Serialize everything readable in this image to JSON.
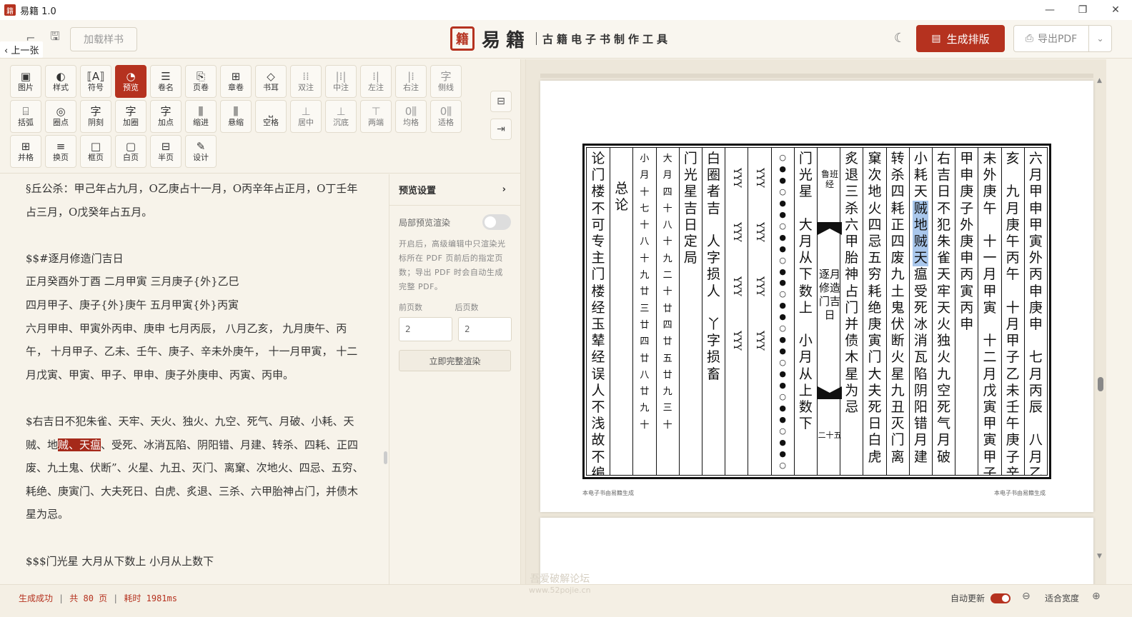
{
  "window": {
    "title": "易籍 1.0",
    "minimize": "—",
    "restore": "❐",
    "close": "✕"
  },
  "header": {
    "back_label": "上一张",
    "load_sample": "加载样书",
    "brand_seal": "籍",
    "brand_name": "易籍",
    "brand_subtitle": "古籍电子书制作工具",
    "generate_label": "生成排版",
    "export_label": "导出PDF",
    "theme_icon": "moon-icon"
  },
  "toolbar": {
    "row1": [
      {
        "icon": "▣",
        "label": "图片"
      },
      {
        "icon": "◐",
        "label": "样式"
      },
      {
        "icon": "⟦A⟧",
        "label": "符号"
      },
      {
        "icon": "◔",
        "label": "预览",
        "active": true
      },
      {
        "icon": "☰",
        "label": "卷名"
      },
      {
        "icon": "⎘",
        "label": "页卷"
      },
      {
        "icon": "⊞",
        "label": "章卷"
      },
      {
        "icon": "◇",
        "label": "书耳"
      },
      {
        "icon": "⁞⁞",
        "label": "双注",
        "dim": true
      },
      {
        "icon": "|⁞|",
        "label": "中注",
        "dim": true
      },
      {
        "icon": "⁞|",
        "label": "左注",
        "dim": true
      },
      {
        "icon": "|⁞",
        "label": "右注",
        "dim": true
      },
      {
        "icon": "字",
        "label": "侧线",
        "dim": true
      }
    ],
    "row2": [
      {
        "icon": "⌸",
        "label": "括弧"
      },
      {
        "icon": "◎",
        "label": "圈点"
      },
      {
        "icon": "字",
        "label": "阴刻"
      },
      {
        "icon": "字",
        "label": "加圈"
      },
      {
        "icon": "字",
        "label": "加点"
      },
      {
        "icon": "⫼",
        "label": "缩进"
      },
      {
        "icon": "⫼",
        "label": "悬缩"
      },
      {
        "icon": "⎵",
        "label": "空格"
      },
      {
        "icon": "⊥",
        "label": "居中",
        "dim": true
      },
      {
        "icon": "⊥",
        "label": "沉底",
        "dim": true
      },
      {
        "icon": "⊤",
        "label": "两端",
        "dim": true
      },
      {
        "icon": "0⫼",
        "label": "均格",
        "dim": true
      },
      {
        "icon": "0⫼",
        "label": "适格",
        "dim": true
      }
    ],
    "row3": [
      {
        "icon": "⊞",
        "label": "并格"
      },
      {
        "icon": "≡",
        "label": "换页"
      },
      {
        "icon": "□",
        "label": "框页"
      },
      {
        "icon": "▢",
        "label": "白页"
      },
      {
        "icon": "⊟",
        "label": "半页"
      },
      {
        "icon": "✎",
        "label": "设计"
      }
    ]
  },
  "editor": {
    "p1": "§丘公杀：甲己年占九月，O乙庚占十一月，O丙辛年占正月，O丁壬年占三月，O戊癸年占五月。",
    "p2": "$$#逐月修造门吉日",
    "p3a": "正月癸酉外丁酉 二月甲寅 三月庚子{外}乙巳",
    "p3b": "四月甲子、庚子{外}庚午 五月甲寅{外}丙寅",
    "p3c": "六月甲申、甲寅外丙申、庚申 七月丙辰， 八月乙亥， 九月庚午、丙午， 十月甲子、乙未、壬午、庚子、辛未外庚午， 十一月甲寅， 十二月戊寅、甲寅、甲子、甲申、庚子外庚申、丙寅、丙申。",
    "p4_pre": "$右吉日不犯朱雀、天牢、天火、独火、九空、死气、月破、小耗、天贼、地",
    "p4_hl": "贼、天瘟",
    "p4_post": "、受死、冰消瓦陷、阴阳错、月建、转杀、四耗、正四废、九土鬼、伏断”、火星、九丑、灭门、离窠、次地火、四忌、五穷、耗绝、庚寅门、大夫死日、白虎、炙退、三杀、六甲胎神占门，并债木星为忌。",
    "p5": "$$$门光星 大月从下数上 小月从上数下"
  },
  "settings": {
    "title": "预览设置",
    "partial_label": "局部预览渲染",
    "desc": "开启后，高级编辑中只渲染光标所在 PDF 页前后的指定页数；导出 PDF 时会自动生成完整 PDF。",
    "before_label": "前页数",
    "after_label": "后页数",
    "before_value": "2",
    "after_value": "2",
    "render_now": "立即完整渲染"
  },
  "preview": {
    "columns": [
      "六月甲申甲寅外丙申庚申 七月丙辰 八月乙",
      "亥 九月庚午丙午 十月甲子乙未壬午庚子辛",
      "未外庚午 十一月甲寅 十二月戊寅甲寅甲子",
      "甲申庚子外庚申丙寅丙申",
      "右吉日不犯朱雀天牢天火独火九空死气月破",
      "小耗天贼地贼天瘟受死冰消瓦陷阴阳错月建",
      "转杀四耗正四废九土鬼伏断火星九丑灭门离",
      "窠次地火四忌五穷耗绝庚寅门大夫死日白虎",
      "炙退三杀六甲胎神占门并债木星为忌"
    ],
    "fish_book": "鲁班经",
    "fish_title": "逐月修造门吉日",
    "fish_page": "二十五",
    "col_menguang": "门光星 大月从下数上 小月从上数下",
    "dots": "○●●○●●○●●○●●○●●○●●○●●○●●○●●○",
    "yy1": "YYY YYY YYY YYY",
    "yy2": "YYY YYY YYY YYY",
    "col_baiquan": "白圈者吉 人字损人 丫字损畜",
    "col_menguang2": "门光星吉日定局",
    "small_left": [
      "大",
      "月",
      "四",
      "十",
      "八",
      "十",
      "九",
      "二",
      "十",
      "廿",
      "四",
      "廿",
      "五",
      "廿",
      "九",
      "三",
      "十"
    ],
    "small_right": [
      "小",
      "月",
      "十",
      "七",
      "十",
      "八",
      "十",
      "九",
      "廿",
      "三",
      "廿",
      "四",
      "廿",
      "八",
      "廿",
      "九",
      "十"
    ],
    "col_zonglun": "总论",
    "col_last": "论门楼不可专主门楼经玉辇经误人不浅故不编",
    "footer_left": "本电子书由易籍生成",
    "footer_right": "本电子书由易籍生成"
  },
  "status": {
    "result": "生成成功",
    "pages": "共 80 页",
    "time": "耗时 1981ms",
    "watermark": "吾爱破解论坛",
    "watermark_url": "www.52pojie.cn",
    "auto_update": "自动更新",
    "fit_width": "适合宽度"
  }
}
